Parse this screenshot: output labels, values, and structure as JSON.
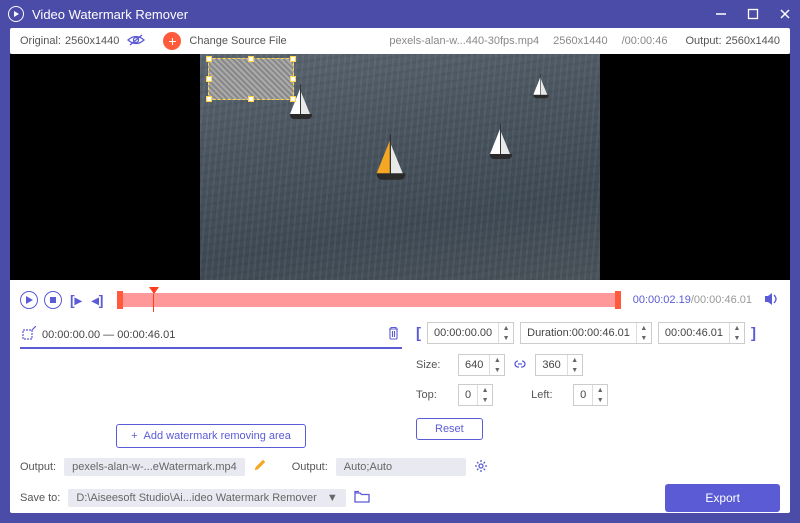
{
  "titlebar": {
    "title": "Video Watermark Remover"
  },
  "infobar": {
    "original_label": "Original:",
    "original_res": "2560x1440",
    "change_label": "Change Source File",
    "filename": "pexels-alan-w...440-30fps.mp4",
    "file_res": "2560x1440",
    "file_dur": "/00:00:46",
    "output_label": "Output:",
    "output_res": "2560x1440"
  },
  "player": {
    "current": "00:00:02.19",
    "total": "/00:00:46.01"
  },
  "segment": {
    "range": "00:00:00.00 — 00:00:46.01"
  },
  "add_btn": "Add watermark removing area",
  "trim": {
    "start": "00:00:00.00",
    "duration_label": "Duration:",
    "duration": "00:00:46.01",
    "end": "00:00:46.01"
  },
  "size": {
    "label": "Size:",
    "w": "640",
    "h": "360"
  },
  "pos": {
    "top_label": "Top:",
    "top": "0",
    "left_label": "Left:",
    "left": "0"
  },
  "reset": "Reset",
  "output": {
    "label": "Output:",
    "filename": "pexels-alan-w-...eWatermark.mp4",
    "format_label": "Output:",
    "format": "Auto;Auto"
  },
  "save": {
    "label": "Save to:",
    "path": "D:\\Aiseesoft Studio\\Ai...ideo Watermark Remover"
  },
  "export": "Export"
}
